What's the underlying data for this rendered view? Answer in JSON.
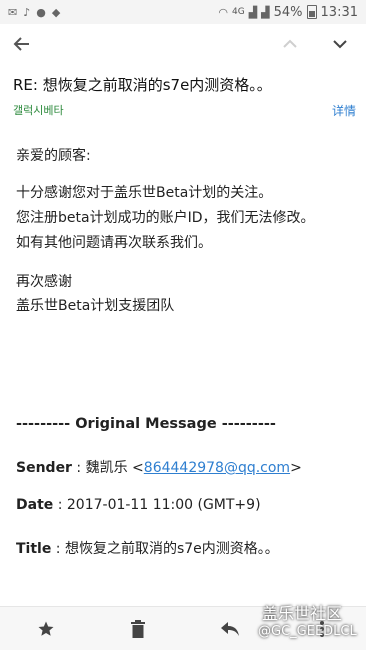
{
  "status_bar": {
    "left_icons": [
      "mail-icon",
      "mic-icon",
      "wechat-icon",
      "qq-icon"
    ],
    "network_label": "4G",
    "battery": "54%",
    "time": "13:31"
  },
  "toolbar": {
    "back_icon": "arrow-left-icon",
    "prev_icon": "chevron-up-icon",
    "next_icon": "chevron-down-icon"
  },
  "email": {
    "subject": "RE: 想恢复之前取消的s7e内测资格。。",
    "sender_name": "갤럭시베타",
    "details_label": "详情",
    "greeting": "亲爱的顾客:",
    "para1": "十分感谢您对于盖乐世Beta计划的关注。",
    "para2": "您注册beta计划成功的账户ID，我们无法修改。",
    "para3": "如有其他问题请再次联系我们。",
    "closing1": "再次感谢",
    "closing2": "盖乐世Beta计划支援团队",
    "original": {
      "header": "--------- Original Message ---------",
      "sender_label": "Sender",
      "sender_name": " : 魏凯乐 <",
      "sender_email": "864442978@qq.com",
      "sender_close": ">",
      "date_label": "Date",
      "date_value": " : 2017-01-11 11:00 (GMT+9)",
      "title_label": "Title",
      "title_value": " : 想恢复之前取消的s7e内测资格。。"
    }
  },
  "bottom_bar": {
    "icons": [
      "star-icon",
      "trash-icon",
      "reply-icon",
      "more-icon"
    ]
  },
  "watermark": {
    "line1": "盖乐世社区",
    "line2": "@GC_GEEDLCL"
  }
}
